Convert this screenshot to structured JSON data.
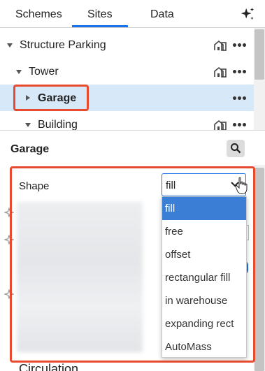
{
  "tabs": [
    {
      "label": "Schemes"
    },
    {
      "label": "Sites",
      "active": true
    },
    {
      "label": "Data"
    }
  ],
  "tree": {
    "rows": [
      {
        "label": "Structure Parking",
        "expanded": true
      },
      {
        "label": "Tower",
        "expanded": true
      },
      {
        "label": "Garage",
        "expanded": false,
        "selected": true
      },
      {
        "label": "Building",
        "expanded": true
      }
    ]
  },
  "panel": {
    "title": "Garage",
    "shape_label": "Shape",
    "shape_value": "fill",
    "shape_options": [
      "fill",
      "free",
      "offset",
      "rectangular fill",
      "in warehouse",
      "expanding rect",
      "AutoMass"
    ],
    "next_section": "Circulation"
  },
  "colors": {
    "accent": "#1a73e8",
    "highlight": "#e84a2f",
    "selected_row": "#d7e8f9",
    "selected_option": "#3a7fd5"
  },
  "icons": [
    "sparkle-icon",
    "building-icon",
    "more-icon",
    "caret-icon",
    "search-icon",
    "chevron-down-icon",
    "hand-cursor-icon"
  ]
}
